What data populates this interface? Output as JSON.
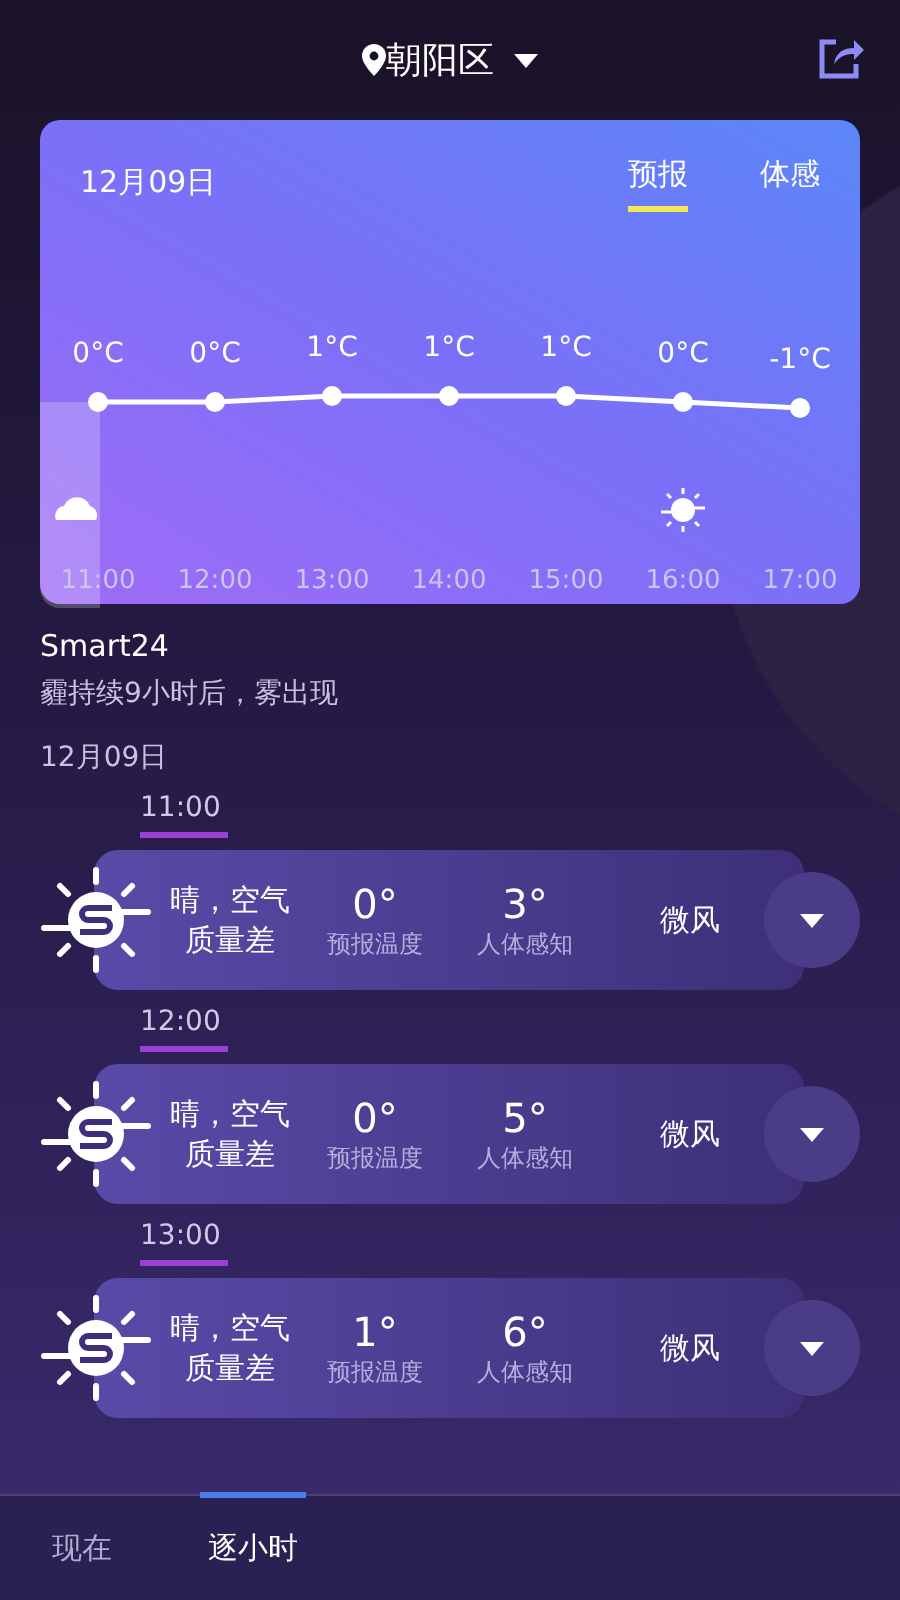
{
  "header": {
    "location": "朝阳区"
  },
  "forecast_card": {
    "date": "12月09日",
    "tabs": [
      {
        "label": "预报",
        "selected": true
      },
      {
        "label": "体感",
        "selected": false
      }
    ],
    "columns": [
      {
        "kind": "cloudy",
        "selected": true
      },
      {
        "kind": "plain",
        "selected": false
      },
      {
        "kind": "plain",
        "selected": false
      },
      {
        "kind": "plain",
        "selected": false
      },
      {
        "kind": "plain",
        "selected": false
      },
      {
        "kind": "sunny",
        "selected": false
      },
      {
        "kind": "plain",
        "selected": false
      }
    ],
    "chart_data": {
      "type": "line",
      "categories": [
        "11:00",
        "12:00",
        "13:00",
        "14:00",
        "15:00",
        "16:00",
        "17:00"
      ],
      "data_labels": true,
      "series": [
        {
          "color": "#ffffff",
          "marker": "o",
          "values": [
            0,
            0,
            1,
            1,
            1,
            0,
            -1
          ],
          "value_labels": [
            "0°C",
            "0°C",
            "1°C",
            "1°C",
            "1°C",
            "0°C",
            "-1°C"
          ]
        }
      ]
    }
  },
  "summary": {
    "title": "Smart24",
    "text": "霾持续9小时后，雾出现"
  },
  "list_date": "12月09日",
  "hours": [
    {
      "time": "11:00",
      "condition": "晴，空气质量差",
      "forecast_temp": "0°",
      "forecast_label": "预报温度",
      "feel_temp": "3°",
      "feel_label": "人体感知",
      "wind": "微风"
    },
    {
      "time": "12:00",
      "condition": "晴，空气质量差",
      "forecast_temp": "0°",
      "forecast_label": "预报温度",
      "feel_temp": "5°",
      "feel_label": "人体感知",
      "wind": "微风"
    },
    {
      "time": "13:00",
      "condition": "晴，空气质量差",
      "forecast_temp": "1°",
      "forecast_label": "预报温度",
      "feel_temp": "6°",
      "feel_label": "人体感知",
      "wind": "微风"
    }
  ],
  "bottom_tabs": [
    {
      "label": "现在",
      "selected": false
    },
    {
      "label": "逐小时",
      "selected": true
    }
  ]
}
